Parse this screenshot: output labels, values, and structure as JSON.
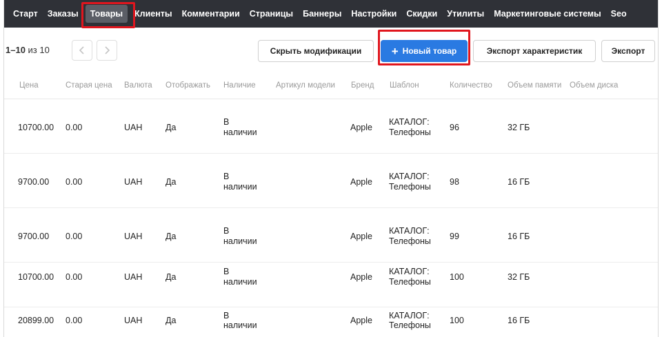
{
  "nav": {
    "items": [
      {
        "label": "Старт"
      },
      {
        "label": "Заказы"
      },
      {
        "label": "Товары",
        "active": true
      },
      {
        "label": "Клиенты"
      },
      {
        "label": "Комментарии"
      },
      {
        "label": "Страницы"
      },
      {
        "label": "Баннеры"
      },
      {
        "label": "Настройки"
      },
      {
        "label": "Скидки"
      },
      {
        "label": "Утилиты"
      },
      {
        "label": "Маркетинговые системы"
      },
      {
        "label": "Seo"
      }
    ]
  },
  "toolbar": {
    "range": "1–10",
    "of_label": "из 10",
    "prev_icon": "chevron-left-icon",
    "next_icon": "chevron-right-icon",
    "hide_mods_label": "Скрыть модификации",
    "new_product_label": "Новый товар",
    "new_product_icon": "plus-icon",
    "export_chars_label": "Экспорт характеристик",
    "export_label": "Экспорт"
  },
  "table": {
    "headers": [
      "Цена",
      "Старая цена",
      "Валюта",
      "Отображать",
      "Наличие",
      "Артикул модели",
      "Бренд",
      "Шаблон",
      "Количество",
      "Объем памяти",
      "Объем диска"
    ],
    "rows": [
      {
        "price": "10700.00",
        "old_price": "0.00",
        "currency": "UAH",
        "display": "Да",
        "avail_1": "В",
        "avail_2": "наличии",
        "sku": "",
        "brand": "Apple",
        "tpl_1": "КАТАЛОГ:",
        "tpl_2": "Телефоны",
        "qty": "96",
        "memory": "32 ГБ",
        "disk": ""
      },
      {
        "price": "9700.00",
        "old_price": "0.00",
        "currency": "UAH",
        "display": "Да",
        "avail_1": "В",
        "avail_2": "наличии",
        "sku": "",
        "brand": "Apple",
        "tpl_1": "КАТАЛОГ:",
        "tpl_2": "Телефоны",
        "qty": "98",
        "memory": "16 ГБ",
        "disk": ""
      },
      {
        "price": "9700.00",
        "old_price": "0.00",
        "currency": "UAH",
        "display": "Да",
        "avail_1": "В",
        "avail_2": "наличии",
        "sku": "",
        "brand": "Apple",
        "tpl_1": "КАТАЛОГ:",
        "tpl_2": "Телефоны",
        "qty": "99",
        "memory": "16 ГБ",
        "disk": ""
      },
      {
        "price": "10700.00",
        "old_price": "0.00",
        "currency": "UAH",
        "display": "Да",
        "avail_1": "В",
        "avail_2": "наличии",
        "sku": "",
        "brand": "Apple",
        "tpl_1": "КАТАЛОГ:",
        "tpl_2": "Телефоны",
        "qty": "100",
        "memory": "32 ГБ",
        "disk": ""
      },
      {
        "price": "20899.00",
        "old_price": "0.00",
        "currency": "UAH",
        "display": "Да",
        "avail_1": "В",
        "avail_2": "наличии",
        "sku": "",
        "brand": "Apple",
        "tpl_1": "КАТАЛОГ:",
        "tpl_2": "Телефоны",
        "qty": "100",
        "memory": "16 ГБ",
        "disk": ""
      }
    ]
  },
  "colors": {
    "nav_bg": "#2f3137",
    "nav_active_bg": "#5b5e66",
    "primary": "#2a7ae2",
    "highlight": "#e0161e"
  }
}
